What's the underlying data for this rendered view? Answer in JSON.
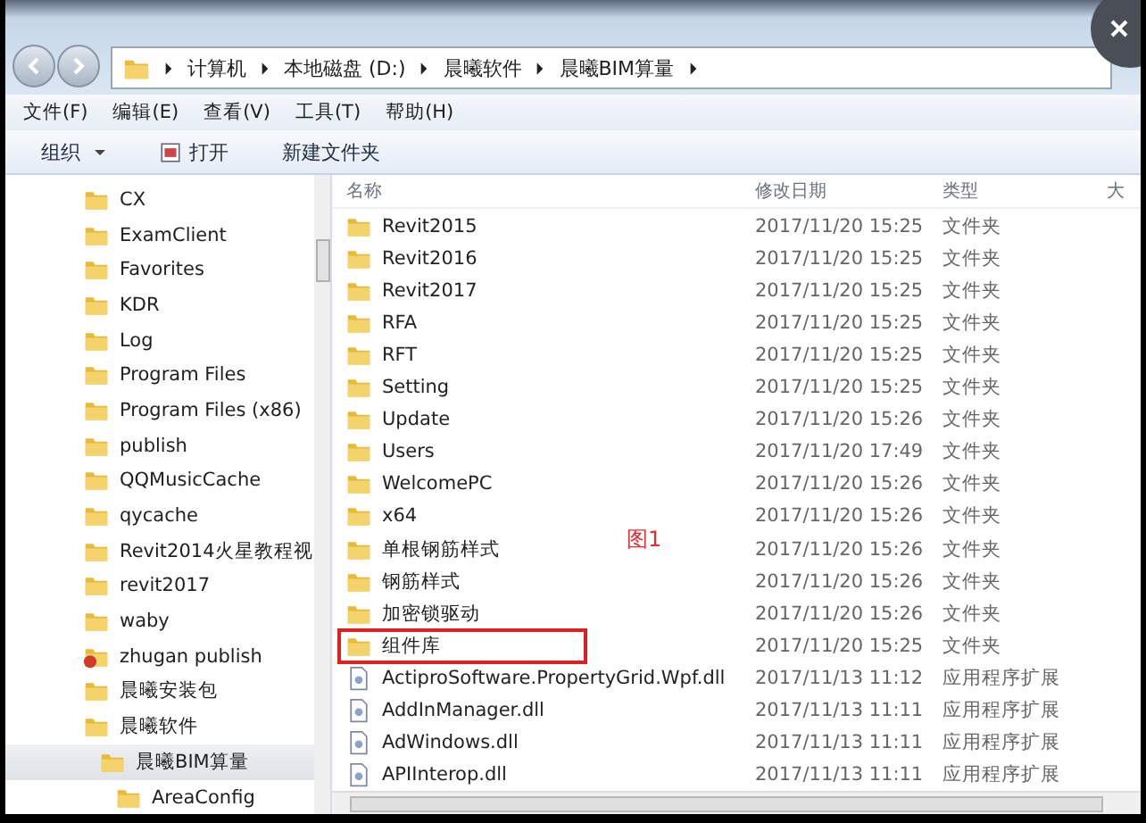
{
  "address_bar": {
    "crumbs": [
      "计算机",
      "本地磁盘 (D:)",
      "晨曦软件",
      "晨曦BIM算量"
    ]
  },
  "menu_bar": [
    "文件(F)",
    "编辑(E)",
    "查看(V)",
    "工具(T)",
    "帮助(H)"
  ],
  "toolbar": [
    {
      "kind": "dropdown",
      "label": "组织"
    },
    {
      "kind": "open",
      "label": "打开"
    },
    {
      "kind": "plain",
      "label": "新建文件夹"
    }
  ],
  "nav_tree": [
    {
      "label": "CX",
      "kind": "folder",
      "selected": false
    },
    {
      "label": "ExamClient",
      "kind": "folder",
      "selected": false
    },
    {
      "label": "Favorites",
      "kind": "folder",
      "selected": false
    },
    {
      "label": "KDR",
      "kind": "folder",
      "selected": false
    },
    {
      "label": "Log",
      "kind": "folder",
      "selected": false
    },
    {
      "label": "Program Files",
      "kind": "folder",
      "selected": false
    },
    {
      "label": "Program Files (x86)",
      "kind": "folder",
      "selected": false
    },
    {
      "label": "publish",
      "kind": "folder",
      "selected": false
    },
    {
      "label": "QQMusicCache",
      "kind": "folder",
      "selected": false
    },
    {
      "label": "qycache",
      "kind": "folder",
      "selected": false
    },
    {
      "label": "Revit2014火星教程视",
      "kind": "folder",
      "selected": false
    },
    {
      "label": "revit2017",
      "kind": "folder",
      "selected": false
    },
    {
      "label": "waby",
      "kind": "folder",
      "selected": false
    },
    {
      "label": "zhugan publish",
      "kind": "special",
      "selected": false
    },
    {
      "label": "晨曦安装包",
      "kind": "folder",
      "selected": false
    },
    {
      "label": "晨曦软件",
      "kind": "folder",
      "selected": false,
      "children": [
        {
          "label": "晨曦BIM算量",
          "kind": "folder",
          "selected": true,
          "children": [
            {
              "label": "AreaConfig",
              "kind": "folder",
              "selected": false
            }
          ]
        }
      ]
    }
  ],
  "file_list": {
    "columns": [
      "名称",
      "修改日期",
      "类型",
      "大"
    ],
    "rows": [
      {
        "name": "Revit2015",
        "kind": "folder",
        "modified": "2017/11/20 15:25",
        "type": "文件夹",
        "highlighted": false
      },
      {
        "name": "Revit2016",
        "kind": "folder",
        "modified": "2017/11/20 15:25",
        "type": "文件夹",
        "highlighted": false
      },
      {
        "name": "Revit2017",
        "kind": "folder",
        "modified": "2017/11/20 15:25",
        "type": "文件夹",
        "highlighted": false
      },
      {
        "name": "RFA",
        "kind": "folder",
        "modified": "2017/11/20 15:25",
        "type": "文件夹",
        "highlighted": false
      },
      {
        "name": "RFT",
        "kind": "folder",
        "modified": "2017/11/20 15:25",
        "type": "文件夹",
        "highlighted": false
      },
      {
        "name": "Setting",
        "kind": "folder",
        "modified": "2017/11/20 15:25",
        "type": "文件夹",
        "highlighted": false
      },
      {
        "name": "Update",
        "kind": "folder",
        "modified": "2017/11/20 15:26",
        "type": "文件夹",
        "highlighted": false
      },
      {
        "name": "Users",
        "kind": "folder",
        "modified": "2017/11/20 17:49",
        "type": "文件夹",
        "highlighted": false
      },
      {
        "name": "WelcomePC",
        "kind": "folder",
        "modified": "2017/11/20 15:26",
        "type": "文件夹",
        "highlighted": false
      },
      {
        "name": "x64",
        "kind": "folder",
        "modified": "2017/11/20 15:26",
        "type": "文件夹",
        "highlighted": false
      },
      {
        "name": "单根钢筋样式",
        "kind": "folder",
        "modified": "2017/11/20 15:26",
        "type": "文件夹",
        "highlighted": false
      },
      {
        "name": "钢筋样式",
        "kind": "folder",
        "modified": "2017/11/20 15:26",
        "type": "文件夹",
        "highlighted": false
      },
      {
        "name": "加密锁驱动",
        "kind": "folder",
        "modified": "2017/11/20 15:26",
        "type": "文件夹",
        "highlighted": false
      },
      {
        "name": "组件库",
        "kind": "folder",
        "modified": "2017/11/20 15:25",
        "type": "文件夹",
        "highlighted": true
      },
      {
        "name": "ActiproSoftware.PropertyGrid.Wpf.dll",
        "kind": "dll",
        "modified": "2017/11/13 11:12",
        "type": "应用程序扩展",
        "highlighted": false
      },
      {
        "name": "AddInManager.dll",
        "kind": "dll",
        "modified": "2017/11/13 11:11",
        "type": "应用程序扩展",
        "highlighted": false
      },
      {
        "name": "AdWindows.dll",
        "kind": "dll",
        "modified": "2017/11/13 11:11",
        "type": "应用程序扩展",
        "highlighted": false
      },
      {
        "name": "APIInterop.dll",
        "kind": "dll",
        "modified": "2017/11/13 11:11",
        "type": "应用程序扩展",
        "highlighted": false
      }
    ],
    "annotation": "图1"
  }
}
